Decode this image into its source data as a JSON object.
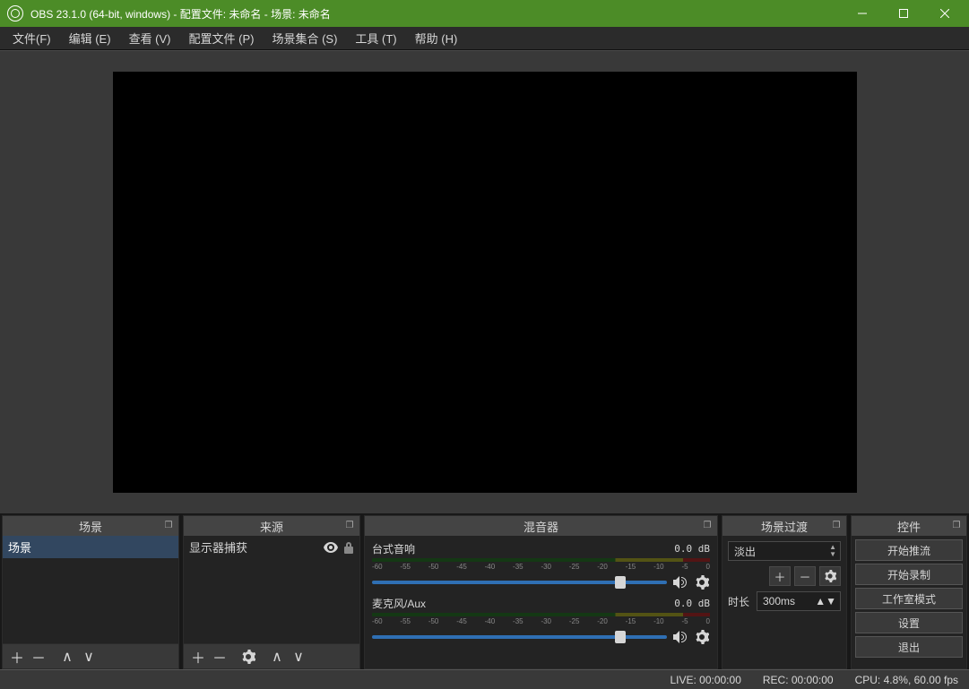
{
  "titlebar": {
    "title": "OBS 23.1.0 (64-bit, windows) - 配置文件: 未命名 - 场景: 未命名"
  },
  "menubar": [
    "文件(F)",
    "编辑 (E)",
    "查看 (V)",
    "配置文件 (P)",
    "场景集合 (S)",
    "工具 (T)",
    "帮助 (H)"
  ],
  "docks": {
    "scenes": {
      "title": "场景",
      "items": [
        "场景"
      ]
    },
    "sources": {
      "title": "来源",
      "items": [
        "显示器捕获"
      ]
    },
    "mixer": {
      "title": "混音器",
      "channels": [
        {
          "name": "台式音响",
          "db": "0.0 dB"
        },
        {
          "name": "麦克风/Aux",
          "db": "0.0 dB"
        }
      ],
      "ticks": [
        "-60",
        "-55",
        "-50",
        "-45",
        "-40",
        "-35",
        "-30",
        "-25",
        "-20",
        "-15",
        "-10",
        "-5",
        "0"
      ]
    },
    "transitions": {
      "title": "场景过渡",
      "selected": "淡出",
      "duration_label": "时长",
      "duration": "300ms"
    },
    "controls": {
      "title": "控件",
      "buttons": [
        "开始推流",
        "开始录制",
        "工作室模式",
        "设置",
        "退出"
      ]
    }
  },
  "statusbar": {
    "live": "LIVE: 00:00:00",
    "rec": "REC: 00:00:00",
    "cpu": "CPU: 4.8%, 60.00 fps"
  }
}
